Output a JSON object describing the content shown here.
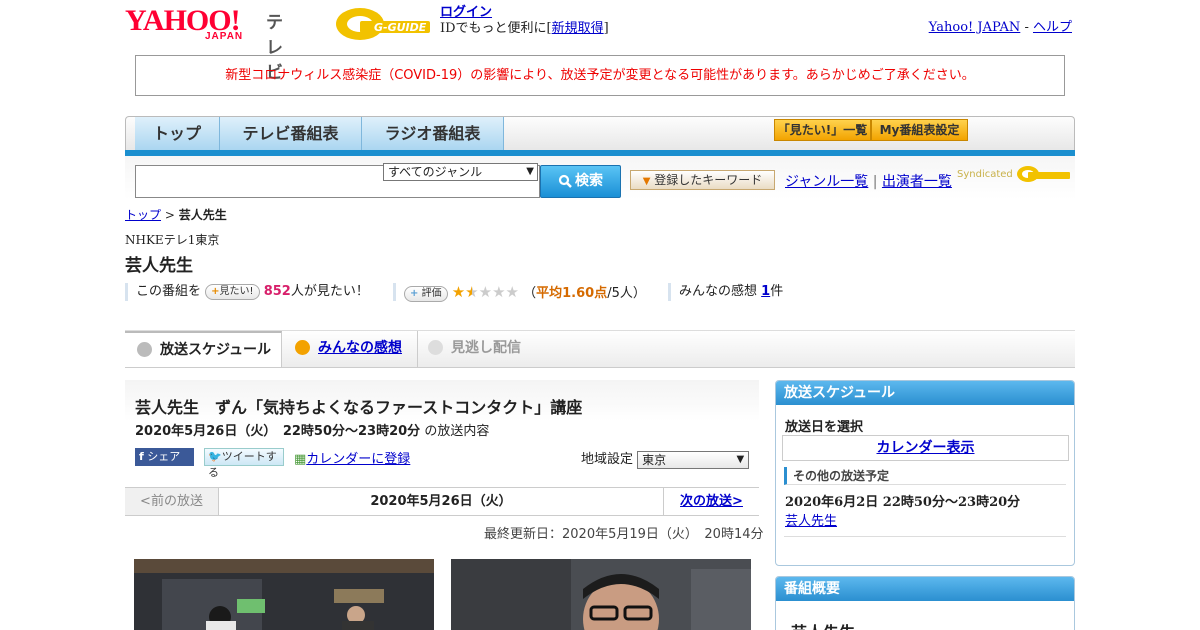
{
  "header": {
    "logo_yahoo": "YAHOO!",
    "logo_yahoo_sub": "JAPAN",
    "logo_tv": "テレビ",
    "logo_gguide": "G-GUIDE",
    "login_link": "ログイン",
    "login_text_pre": "IDでもっと便利に[",
    "login_register_link": "新規取得",
    "login_text_post": "]",
    "top_link_yahoo": "Yahoo! JAPAN",
    "top_sep": "-",
    "top_link_help": "ヘルプ"
  },
  "notice": "新型コロナウィルス感染症（COVID-19）の影響により、放送予定が変更となる可能性があります。あらかじめご了承ください。",
  "nav": {
    "tabs": [
      "トップ",
      "テレビ番組表",
      "ラジオ番組表"
    ],
    "btn_mitai": "「見たい!」一覧",
    "btn_my": "My番組表設定"
  },
  "search": {
    "genre_selected": "すべてのジャンル",
    "search_button": "検索",
    "keyword_button": "登録したキーワード",
    "link_genre": "ジャンル一覧",
    "link_sep": "|",
    "link_cast": "出演者一覧",
    "syndicated": "Syndicated"
  },
  "breadcrumb": {
    "top": "トップ",
    "sep": ">",
    "current": "芸人先生"
  },
  "program": {
    "station": "NHKEテレ1東京",
    "title": "芸人先生",
    "want_pre": "この番組を",
    "want_button": "見たい!",
    "want_count": "852",
    "want_post": "人が見たい！",
    "rating_button": "評価",
    "rating_open": "（",
    "rating_avg": "平均1.60点",
    "rating_count": "/5人）",
    "rating_value": 1.6,
    "rating_max": 5,
    "impressions_pre": "みんなの感想",
    "impressions_count": "1",
    "impressions_post": "件"
  },
  "tabs": {
    "schedule": "放送スケジュール",
    "impressions": "みんなの感想",
    "vod": "見逃し配信"
  },
  "episode": {
    "title": "芸人先生　ずん「気持ちよくなるファーストコンタクト」講座",
    "datetime": "2020年5月26日（火）　22時50分～23時20分",
    "datetime_suffix": "の放送内容",
    "share_fb": "シェア",
    "share_tw": "ツイートする",
    "calendar_link": "カレンダーに登録",
    "region_label": "地域設定",
    "region_value": "東京"
  },
  "date_nav": {
    "prev": "<前の放送",
    "current": "2020年5月26日（火）",
    "next": "次の放送>"
  },
  "updated": "最終更新日：2020年5月19日（火）　20時14分",
  "sidebar": {
    "schedule_head": "放送スケジュール",
    "select_date": "放送日を選択",
    "calendar_link": "カレンダー表示",
    "other_head": "その他の放送予定",
    "other_datetime": "2020年6月2日  22時50分～23時20分",
    "other_title": "芸人先生",
    "summary_head": "番組概要",
    "summary_title": "芸人先生"
  },
  "colors": {
    "accent_blue": "#1b8fcf",
    "notice_red": "#e00000",
    "rating_orange": "#d56a00",
    "want_pink": "#d8206b"
  }
}
